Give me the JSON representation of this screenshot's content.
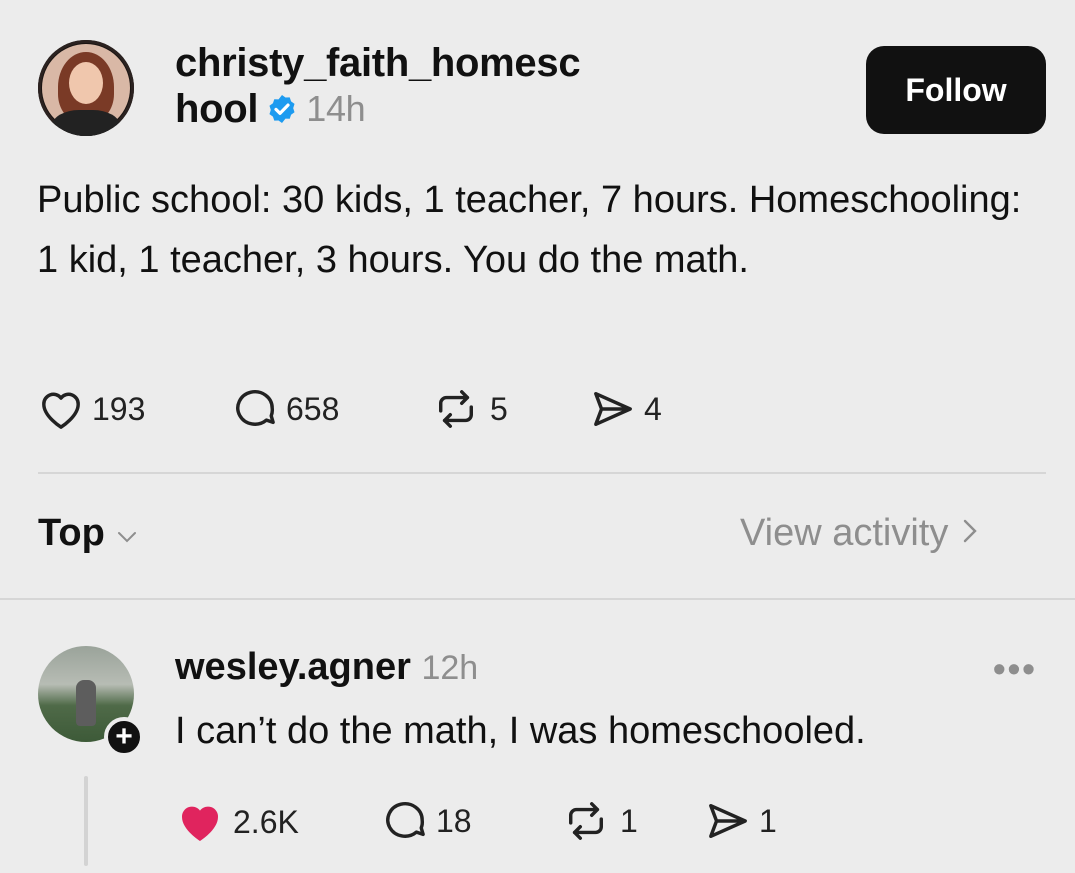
{
  "post": {
    "username_line1": "christy_faith_homesc",
    "username_line2": "hool",
    "time": "14h",
    "follow_label": "Follow",
    "text": "Public school: 30 kids, 1 teacher, 7 hours. Homeschooling: 1 kid, 1 teacher, 3 hours. You do the math.",
    "actions": {
      "likes": "193",
      "replies": "658",
      "reposts": "5",
      "shares": "4"
    }
  },
  "sort": {
    "label": "Top",
    "view_activity": "View activity"
  },
  "reply": {
    "username": "wesley.agner",
    "time": "12h",
    "text": "I can’t do the math, I was homeschooled.",
    "actions": {
      "likes": "2.6K",
      "replies": "18",
      "reposts": "1",
      "shares": "1"
    },
    "like_color": "#e0245e"
  },
  "colors": {
    "verified": "#1d9bf0",
    "muted": "#8e8e8e",
    "button_bg": "#111111"
  },
  "icons": {
    "verified": "verified-badge-icon",
    "like": "heart-icon",
    "reply": "comment-bubble-icon",
    "repost": "repost-icon",
    "share": "send-icon",
    "chevron_down": "chevron-down-icon",
    "chevron_right": "chevron-right-icon",
    "more": "more-horizontal-icon",
    "follow_plus": "plus-icon"
  }
}
